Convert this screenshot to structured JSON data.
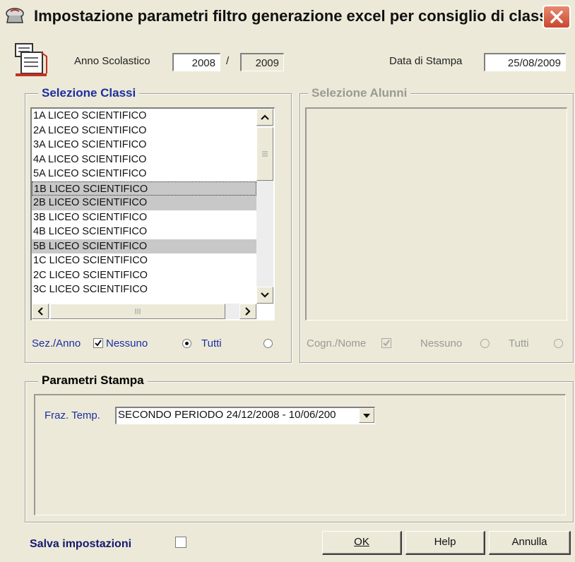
{
  "window": {
    "title": "Impostazione parametri filtro generazione excel per consiglio di classe"
  },
  "header": {
    "anno_label": "Anno Scolastico",
    "anno_start": "2008",
    "anno_sep": "/",
    "anno_end": "2009",
    "data_label": "Data di Stampa",
    "data_value": "25/08/2009"
  },
  "selezione_classi": {
    "title": "Selezione Classi",
    "items": [
      {
        "label": "1A LICEO SCIENTIFICO",
        "selected": false
      },
      {
        "label": "2A LICEO SCIENTIFICO",
        "selected": false
      },
      {
        "label": "3A LICEO SCIENTIFICO",
        "selected": false
      },
      {
        "label": "4A LICEO SCIENTIFICO",
        "selected": false
      },
      {
        "label": "5A LICEO SCIENTIFICO",
        "selected": false
      },
      {
        "label": "1B LICEO SCIENTIFICO",
        "selected": true,
        "focused": true
      },
      {
        "label": "2B LICEO SCIENTIFICO",
        "selected": true
      },
      {
        "label": "3B LICEO SCIENTIFICO",
        "selected": false
      },
      {
        "label": "4B LICEO SCIENTIFICO",
        "selected": false
      },
      {
        "label": "5B LICEO SCIENTIFICO",
        "selected": true
      },
      {
        "label": "1C LICEO SCIENTIFICO",
        "selected": false
      },
      {
        "label": "2C LICEO SCIENTIFICO",
        "selected": false
      },
      {
        "label": "3C LICEO SCIENTIFICO",
        "selected": false
      }
    ],
    "sez_label": "Sez./Anno",
    "sez_checked": true,
    "nessuno_label": "Nessuno",
    "nessuno_selected": true,
    "tutti_label": "Tutti",
    "tutti_selected": false
  },
  "selezione_alunni": {
    "title": "Selezione Alunni",
    "cogn_label": "Cogn./Nome",
    "nessuno_label": "Nessuno",
    "tutti_label": "Tutti"
  },
  "parametri_stampa": {
    "title": "Parametri Stampa",
    "fraz_label": "Fraz. Temp.",
    "fraz_value": "SECONDO PERIODO 24/12/2008 - 10/06/200"
  },
  "footer": {
    "salva_label": "Salva impostazioni",
    "salva_checked": false,
    "ok_label": "OK",
    "help_label": "Help",
    "annulla_label": "Annulla"
  },
  "colors": {
    "dialog_bg": "#ece9d8",
    "label_blue": "#1c2fa0",
    "close_red": "#c9462e",
    "selection_gray": "#c8c8c8"
  }
}
